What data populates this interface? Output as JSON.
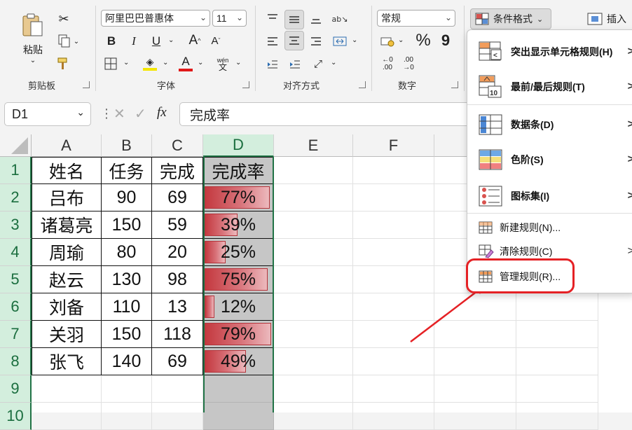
{
  "ribbon": {
    "clipboard": {
      "paste_label": "粘贴",
      "group_label": "剪贴板"
    },
    "font": {
      "font_name": "阿里巴巴普惠体",
      "font_size": "11",
      "group_label": "字体",
      "bold": "B",
      "italic": "I",
      "underline": "U",
      "grow": "A",
      "shrink": "A",
      "font_color": "A",
      "phonetic_top": "wén",
      "phonetic_bottom": "文"
    },
    "alignment": {
      "group_label": "对齐方式"
    },
    "number": {
      "format": "常规",
      "percent": "%",
      "comma": "9",
      "group_label": "数字",
      "inc_top": "←0",
      "inc_bottom": ".00",
      "dec_top": ".00",
      "dec_bottom": "→0"
    },
    "styles": {
      "conditional_format": "条件格式"
    },
    "cells": {
      "insert": "插入"
    },
    "colors": {
      "accent_green": "#217346",
      "highlight_red": "#e52125",
      "font_red": "#e01818",
      "fill_yellow": "#f4e600"
    }
  },
  "formula_bar": {
    "name_box": "D1",
    "fx": "fx",
    "content": "完成率"
  },
  "sheet": {
    "columns": [
      "A",
      "B",
      "C",
      "D",
      "E",
      "F"
    ],
    "rows": [
      "1",
      "2",
      "3",
      "4",
      "5",
      "6",
      "7",
      "8",
      "9",
      "10"
    ],
    "header": [
      "姓名",
      "任务",
      "完成",
      "完成率"
    ],
    "data": [
      {
        "name": "吕布",
        "task": "90",
        "done": "69",
        "rate": "77%",
        "rate_value": 0.77
      },
      {
        "name": "诸葛亮",
        "task": "150",
        "done": "59",
        "rate": "39%",
        "rate_value": 0.39
      },
      {
        "name": "周瑜",
        "task": "80",
        "done": "20",
        "rate": "25%",
        "rate_value": 0.25
      },
      {
        "name": "赵云",
        "task": "130",
        "done": "98",
        "rate": "75%",
        "rate_value": 0.75
      },
      {
        "name": "刘备",
        "task": "110",
        "done": "13",
        "rate": "12%",
        "rate_value": 0.12
      },
      {
        "name": "关羽",
        "task": "150",
        "done": "118",
        "rate": "79%",
        "rate_value": 0.79
      },
      {
        "name": "张飞",
        "task": "140",
        "done": "69",
        "rate": "49%",
        "rate_value": 0.49
      }
    ]
  },
  "cf_menu": {
    "items": [
      {
        "label": "突出显示单元格规则(H)",
        "icon": "highlight-cells-rules-icon"
      },
      {
        "label": "最前/最后规则(T)",
        "icon": "top-bottom-rules-icon"
      },
      {
        "label": "数据条(D)",
        "icon": "data-bars-icon"
      },
      {
        "label": "色阶(S)",
        "icon": "color-scales-icon"
      },
      {
        "label": "图标集(I)",
        "icon": "icon-sets-icon"
      }
    ],
    "actions": [
      {
        "label": "新建规则(N)...",
        "icon": "new-rule-icon"
      },
      {
        "label": "清除规则(C)",
        "icon": "clear-rules-icon"
      },
      {
        "label": "管理规则(R)...",
        "icon": "manage-rules-icon"
      }
    ],
    "chevron": ">"
  }
}
